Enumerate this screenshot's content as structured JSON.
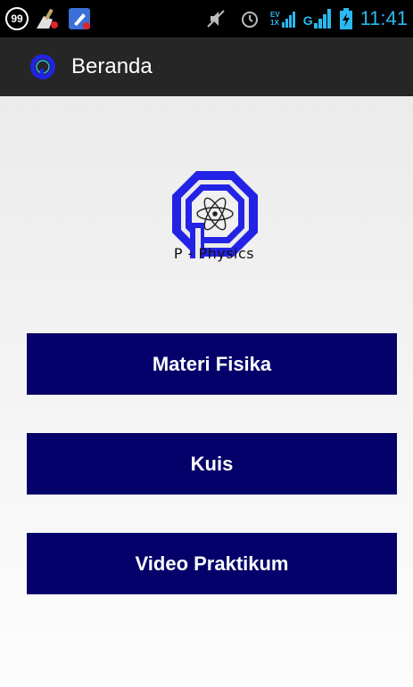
{
  "status_bar": {
    "notification_count": "99",
    "time": "11:41",
    "network_top": "EV",
    "network_bottom": "1X",
    "signal_label": "G",
    "icons": [
      "cleaner-app-icon",
      "rocket-app-icon",
      "muted-icon",
      "alarm-icon",
      "data-signal-icon",
      "cell-signal-icon",
      "battery-charging-icon"
    ]
  },
  "action_bar": {
    "title": "Beranda",
    "icon": "app-logo-icon"
  },
  "main": {
    "logo_text": "P - Physics",
    "buttons": [
      {
        "label": "Materi Fisika"
      },
      {
        "label": "Kuis"
      },
      {
        "label": "Video Praktikum"
      }
    ]
  },
  "colors": {
    "button_bg": "#04026a",
    "action_bar_bg": "#262626",
    "status_accent": "#2ab8ef",
    "logo_blue": "#2323e6"
  }
}
